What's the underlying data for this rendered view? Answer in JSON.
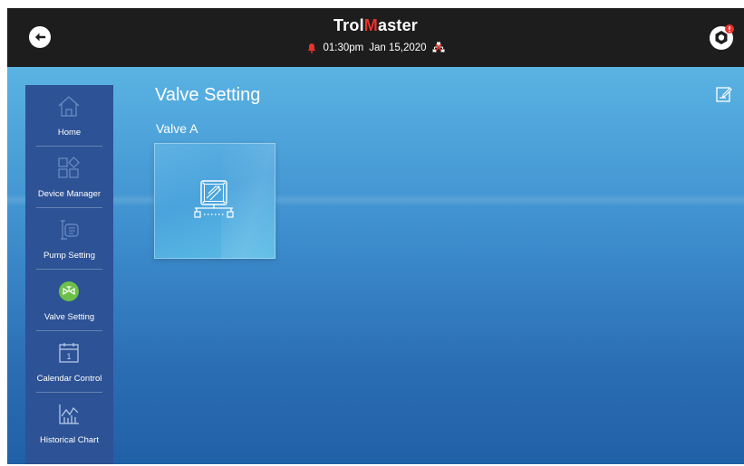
{
  "header": {
    "brand_prefix": "Trol",
    "brand_m": "M",
    "brand_suffix": "aster",
    "time": "01:30pm",
    "date": "Jan 15,2020"
  },
  "sidebar": {
    "items": [
      {
        "label": "Home",
        "icon": "home-icon"
      },
      {
        "label": "Device Manager",
        "icon": "device-manager-icon"
      },
      {
        "label": "Pump Setting",
        "icon": "pump-icon"
      },
      {
        "label": "Valve Setting",
        "icon": "valve-icon",
        "active": true
      },
      {
        "label": "Calendar Control",
        "icon": "calendar-icon"
      },
      {
        "label": "Historical Chart",
        "icon": "chart-icon"
      }
    ]
  },
  "main": {
    "title": "Valve Setting",
    "section": "Valve A",
    "calendar_day": "1"
  },
  "colors": {
    "topbar": "#1d1d1d",
    "brand_accent": "#e8322c",
    "sidebar": "#2d5295",
    "active_icon": "#6cc04a",
    "alert": "#e8322c"
  }
}
